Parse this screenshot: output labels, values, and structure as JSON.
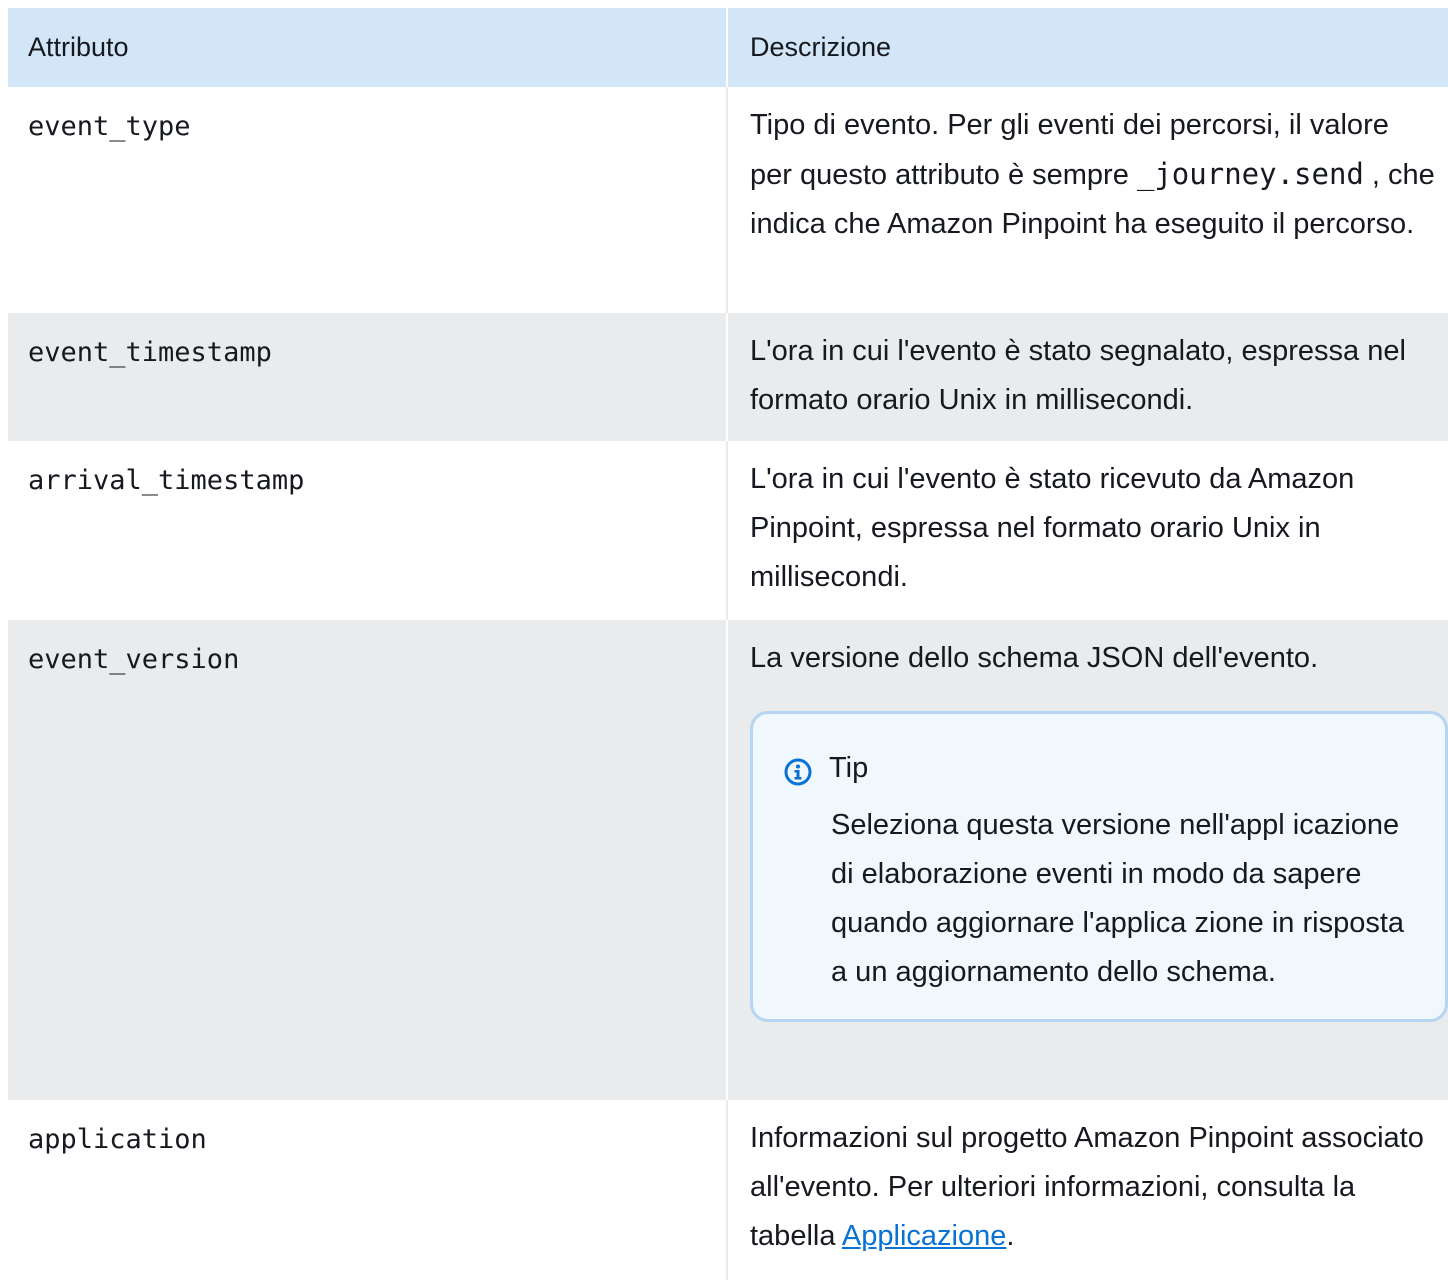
{
  "header": {
    "col1": "Attributo",
    "col2": "Descrizione"
  },
  "rows": {
    "r0": {
      "attr": "event_type",
      "desc_a": "Tipo di evento. Per gli eventi dei percorsi, il valore per questo attributo è sempre ",
      "desc_code": "_journey.send",
      "desc_b": " , che indica che Amazon Pinpoint ha eseguito il percorso."
    },
    "r1": {
      "attr": "event_timestamp",
      "desc": "L'ora in cui l'evento è stato segnalato, espressa nel formato orario Unix in millisecondi."
    },
    "r2": {
      "attr": "arrival_timestamp",
      "desc": "L'ora in cui l'evento è stato ricevuto da Amazon Pinpoint, espressa nel formato orario Unix in millisecondi."
    },
    "r3": {
      "attr": "event_version",
      "desc": "La versione dello schema JSON dell'evento.",
      "tip_title": "Tip",
      "tip_body": "Seleziona questa versione nell'appl icazione di elaborazione eventi in modo da sapere quando aggiornare l'applica zione in risposta a un aggiornamento dello schema."
    },
    "r4": {
      "attr": "application",
      "desc_a": "Informazioni sul progetto Amazon Pinpoint associato all'evento. Per ulteriori informazioni, consulta la tabella ",
      "link": "Applicazione",
      "desc_b": "."
    }
  },
  "colors": {
    "header_bg": "#d3e6f7",
    "alt_row_bg": "#e9ebed",
    "link": "#0972d3",
    "tip_bg": "#f0f7fd",
    "tip_border": "#b6d5f2"
  },
  "icons": {
    "tip": "info-icon"
  }
}
